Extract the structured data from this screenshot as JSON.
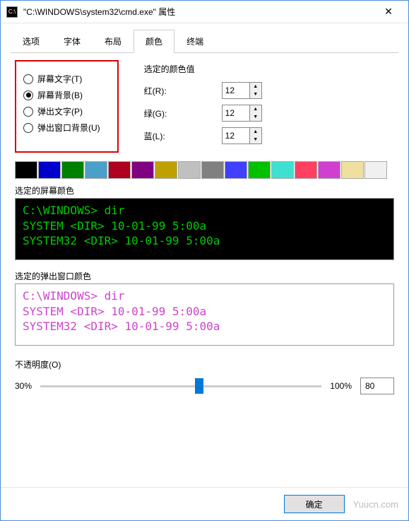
{
  "titlebar": {
    "icon_name": "cmd-icon",
    "title": "\"C:\\WINDOWS\\system32\\cmd.exe\" 属性"
  },
  "tabs": {
    "items": [
      "选项",
      "字体",
      "布局",
      "颜色",
      "终端"
    ],
    "active_index": 3
  },
  "radios": {
    "items": [
      {
        "label": "屏幕文字(T)",
        "checked": false
      },
      {
        "label": "屏幕背景(B)",
        "checked": true
      },
      {
        "label": "弹出文字(P)",
        "checked": false
      },
      {
        "label": "弹出窗口背景(U)",
        "checked": false
      }
    ]
  },
  "rgb": {
    "title": "选定的颜色值",
    "rows": [
      {
        "label": "红(R):",
        "value": "12"
      },
      {
        "label": "绿(G):",
        "value": "12"
      },
      {
        "label": "蓝(L):",
        "value": "12"
      }
    ]
  },
  "palette": [
    "#000000",
    "#0000cc",
    "#008000",
    "#4aa0c8",
    "#b00020",
    "#800080",
    "#c0a000",
    "#c0c0c0",
    "#808080",
    "#4040ff",
    "#00c000",
    "#40e0d0",
    "#ff4060",
    "#d040d0",
    "#f0e0a0",
    "#f0f0f0"
  ],
  "screen_preview": {
    "label": "选定的屏幕颜色",
    "lines": [
      "C:\\WINDOWS> dir",
      "SYSTEM       <DIR>     10-01-99   5:00a",
      "SYSTEM32     <DIR>     10-01-99   5:00a"
    ]
  },
  "popup_preview": {
    "label": "选定的弹出窗口颜色",
    "lines": [
      "C:\\WINDOWS> dir",
      "SYSTEM       <DIR>     10-01-99   5:00a",
      "SYSTEM32     <DIR>     10-01-99   5:00a"
    ]
  },
  "opacity": {
    "label": "不透明度(O)",
    "min_label": "30%",
    "max_label": "100%",
    "value": "80"
  },
  "footer": {
    "ok": "确定",
    "watermark": "Yuucn.com"
  }
}
